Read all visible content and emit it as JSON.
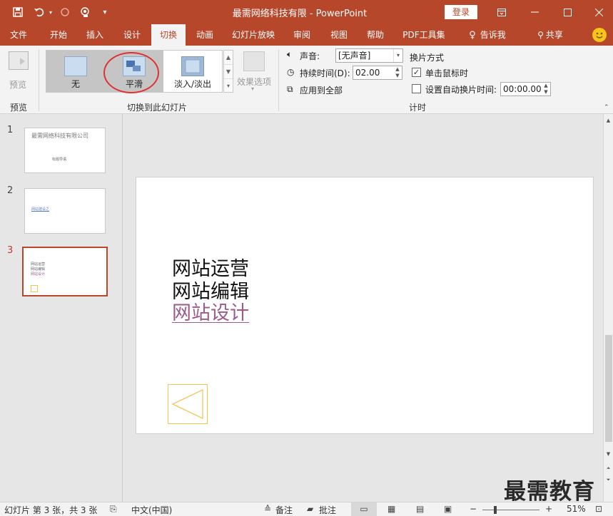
{
  "titlebar": {
    "title": "最需网络科技有限  -  PowerPoint",
    "login_label": "登录",
    "colors": {
      "accent": "#b7472a",
      "text": "#ffffff"
    },
    "icons": [
      "save-icon",
      "undo-icon",
      "redo-icon",
      "touch-mode-icon",
      "customize-icon",
      "ribbon-display-icon",
      "minimize-icon",
      "maximize-icon",
      "close-icon"
    ]
  },
  "tabs": [
    {
      "label": "文件",
      "active": false
    },
    {
      "label": "开始",
      "active": false
    },
    {
      "label": "插入",
      "active": false
    },
    {
      "label": "设计",
      "active": false
    },
    {
      "label": "切换",
      "active": true
    },
    {
      "label": "动画",
      "active": false
    },
    {
      "label": "幻灯片放映",
      "active": false
    },
    {
      "label": "审阅",
      "active": false
    },
    {
      "label": "视图",
      "active": false
    },
    {
      "label": "帮助",
      "active": false
    },
    {
      "label": "PDF工具集",
      "active": false
    }
  ],
  "tell_me": "告诉我",
  "share": "共享",
  "ribbon": {
    "preview": {
      "button_label": "预览",
      "group_label": "预览"
    },
    "transitions": {
      "items": [
        {
          "label": "无",
          "selected": true
        },
        {
          "label": "平滑",
          "selected": false
        },
        {
          "label": "淡入/淡出",
          "selected": false
        }
      ],
      "effect_options_label": "效果选项",
      "group_label": "切换到此幻灯片"
    },
    "timing": {
      "sound_label": "声音:",
      "sound_value": "[无声音]",
      "duration_label": "持续时间(D):",
      "duration_value": "02.00",
      "apply_all_label": "应用到全部",
      "advance_label": "换片方式",
      "on_click_label": "单击鼠标时",
      "on_click_checked": true,
      "after_label": "设置自动换片时间:",
      "after_checked": false,
      "after_value": "00:00.00",
      "group_label": "计时"
    }
  },
  "slides": [
    {
      "number": "1",
      "title": "最需网络科技有限公司",
      "subtitle": "标题导语"
    },
    {
      "number": "2",
      "link": "网站建设之"
    },
    {
      "number": "3",
      "lines": [
        "网站运营",
        "网站编辑",
        "网站设计"
      ],
      "current": true
    }
  ],
  "current_slide": {
    "lines": [
      "网站运营",
      "网站编辑"
    ],
    "link_line": "网站设计"
  },
  "statusbar": {
    "slide_info": "幻灯片 第 3 张，共 3 张",
    "language": "中文(中国)",
    "notes_label": "备注",
    "comments_label": "批注",
    "zoom": "51%",
    "zoom_percent": 51
  },
  "watermark": "最需教育"
}
